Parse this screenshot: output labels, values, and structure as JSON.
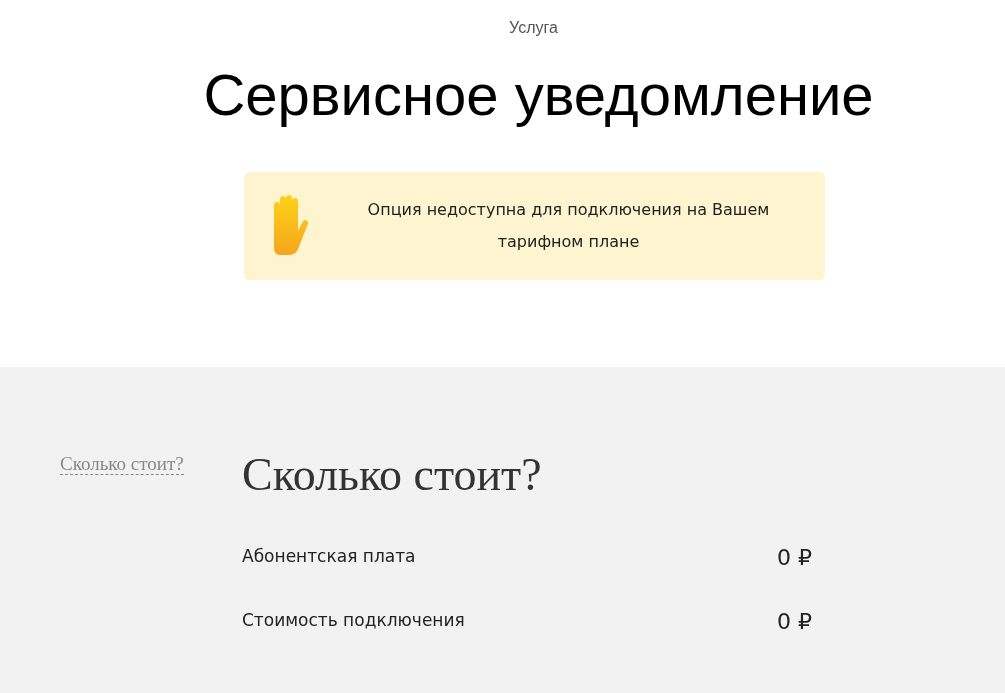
{
  "header": {
    "category": "Услуга",
    "title": "Сервисное уведомление"
  },
  "notice": {
    "text": "Опция недоступна для подключения на Вашем тарифном плане"
  },
  "pricing": {
    "nav_link": "Сколько стоит?",
    "title": "Сколько стоит?",
    "rows": [
      {
        "label": "Абонентская плата",
        "price": "0 ₽"
      },
      {
        "label": "Стоимость подключения",
        "price": "0 ₽"
      }
    ]
  }
}
